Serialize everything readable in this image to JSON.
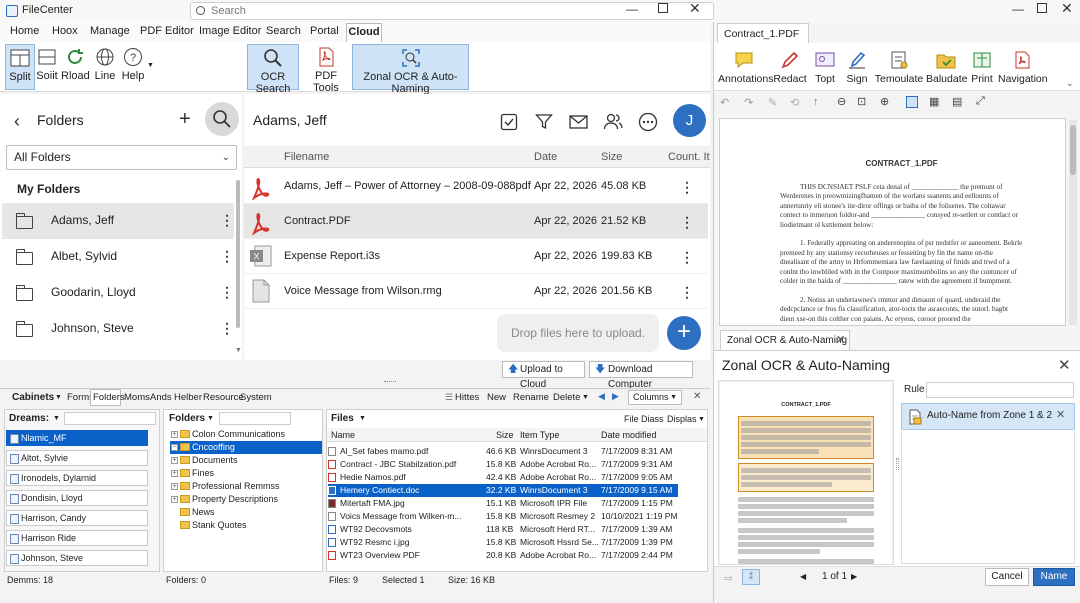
{
  "app": {
    "title": "FileCenter",
    "search_placeholder": "Search"
  },
  "menu": {
    "items": [
      "Home",
      "Hoox",
      "Manage",
      "PDF Editor",
      "Image Editor",
      "Search",
      "Portal"
    ],
    "active": "Cloud"
  },
  "ribbon": {
    "split": "Split",
    "soiit": "Soiit",
    "rload": "Rload",
    "line": "Line",
    "help": "Help",
    "ocr_search": "OCR Search",
    "pdf_tools": "PDF Tools",
    "zonal": "Zonal OCR & Auto-Naming"
  },
  "folders": {
    "title": "Folders",
    "filter": "All Folders",
    "section": "My Folders",
    "items": [
      "Adams, Jeff",
      "Albet, Sylvid",
      "Goodarin, Lloyd",
      "Johnson, Steve"
    ]
  },
  "contact": {
    "name": "Adams, Jeff",
    "avatar": "J"
  },
  "filelist": {
    "headers": {
      "name": "Filename",
      "date": "Date",
      "size": "Size",
      "count": "Count. It"
    },
    "rows": [
      {
        "name": "Adams, Jeff – Power of Attorney – 2008-09-088pdf",
        "date": "Apr 22, 2026",
        "size": "45.08 KB"
      },
      {
        "name": "Contract.PDF",
        "date": "Apr 22, 2026",
        "size": "21.52 KB"
      },
      {
        "name": "Expense Report.i3s",
        "date": "Apr 22, 2026",
        "size": "199.83 KB"
      },
      {
        "name": "Voice Message from Wilson.rmg",
        "date": "Apr 22, 2026",
        "size": "201.56 KB"
      }
    ],
    "drop": "Drop files here to upload.",
    "upload": "Upload to Cloud",
    "download": "Download Computer"
  },
  "bottom": {
    "tabs": [
      "Cabinets",
      "Forms",
      "Folders",
      "Moms",
      "Ands",
      "Helber",
      "Resource",
      "System"
    ],
    "actions": [
      "Hittes",
      "New",
      "Rename",
      "Delete"
    ],
    "columns": "Columns",
    "drawers_label": "Dreams:",
    "drawers": [
      "Nlamic_MF",
      "Altot, Sylvie",
      "Ironodels, Dylarnid",
      "Dondisin, Lloyd",
      "Harrison, Candy",
      "Harrison Ride",
      "Johnson, Steve"
    ],
    "drawers_count": "Demms: 18",
    "folders_label": "Folders",
    "tree": [
      "Colon Communications",
      "Cncooffing",
      "Documents",
      "Fines",
      "Professional Remmss",
      "Property Descriptions",
      "News",
      "Stank Quotes"
    ],
    "folders_count": "Folders: 0",
    "files_label": "Files",
    "file_diss": "File Diass",
    "displas": "Displas",
    "file_headers": {
      "name": "Name",
      "size": "Size",
      "type": "Item Type",
      "date": "Date modified"
    },
    "files": [
      {
        "name": "Al_Set fabes mamo.pdf",
        "size": "46.6 KB",
        "type": "WinrsDocument 3",
        "date": "7/17/2009 8:31 AM"
      },
      {
        "name": "Contract - JBC Stabilzation.pdf",
        "size": "15.8 KB",
        "type": "Adobe Acrobat Ro...",
        "date": "7/17/2009 9:31 AM"
      },
      {
        "name": "Hedie Namos.pdf",
        "size": "42.4 KB",
        "type": "Adobe Acrobat Ro...",
        "date": "7/17/2009 9:05 AM"
      },
      {
        "name": "Hemery Contiect.doc",
        "size": "32.2 KB",
        "type": "WinrsDocument 3",
        "date": "7/17/2009 9.15 AM"
      },
      {
        "name": "Mitertaft FMA.jpg",
        "size": "15.1 KB",
        "type": "Microsoft IPR File",
        "date": "7/17/2009 1:15 PM"
      },
      {
        "name": "Voics Message from Wilken-m...",
        "size": "15.8 KB",
        "type": "Microsoft Resmey 2",
        "date": "10/10/2021 1:19 PM"
      },
      {
        "name": "WT92 Decovsmots",
        "size": "118 KB",
        "type": "Microsoft Herd RT...",
        "date": "7/17/2009 1:39 AM"
      },
      {
        "name": "WT92 Resmc i.jpg",
        "size": "15.8 KB",
        "type": "Microsoft Hssrd Se...",
        "date": "7/17/2009 1:39 PM"
      },
      {
        "name": "WT23 Overview PDF",
        "size": "20.8 KB",
        "type": "Adobe Acrobat Ro...",
        "date": "7/17/2009 2:44 PM"
      }
    ],
    "status_files": "Files: 9",
    "status_selected": "Selected 1",
    "status_size": "Size: 16 KB"
  },
  "viewer": {
    "tab": "Contract_1.PDF",
    "tools": [
      "Annotations",
      "Redact",
      "Topt",
      "Sign",
      "Temoulate",
      "Baludate",
      "Print",
      "Navigation"
    ],
    "doc_title": "CONTRACT_1.PDF",
    "doc_p1": "THIS DCNSIAET PSLF ceta denal of _____________ the premunt of Werderenes in preowmizingfhamen of the worlans ssanents and eellounts of annertsnriy eli stonee's inr-diror offings or baiba of the folisenes. The coltawar contect to inmeruon foldor-and _______________ consyed re-setlert or contlact or liodietmant ol ksttlement below:",
    "doc_p2": "1.  Federally appreating on anderenopins of psr nedstfer or aaneoment. Bekrle premeed by any stationsy recurheuses or fesseiting by fin the name on-the dnealisant of the artny to Hrfommemiara law farelaaning of finids and trwd of a conlnt tho inwbliled with in the Contpoor maximumbolins so any the contuncer of colder in the baida of _______________ ratew with the agreement if bumpment.",
    "doc_p3": "2.  Notiss an undertawnes's rmmor and dimaunt of quard, underaid the dedcpclance or fros fis classification, ator-tocts the asraeconts, the sutorl. bagbt dieut xse-on this colther con paians. Ac eryeus, coroor proored the"
  },
  "zonal": {
    "tab": "Zonal OCR & Auto-Naming",
    "title": "Zonal OCR & Auto-Naming",
    "rule_label": "Rule",
    "rule_item": "Auto-Name from Zone 1 & 2",
    "page_of": "1  of 1",
    "cancel": "Cancel",
    "name_btn": "Name",
    "thumb_title": "CONTRACT_1.PDF"
  },
  "colors": {
    "accent": "#2d6fc0",
    "selection": "#0a62c9",
    "pdf_red": "#d9302a"
  }
}
